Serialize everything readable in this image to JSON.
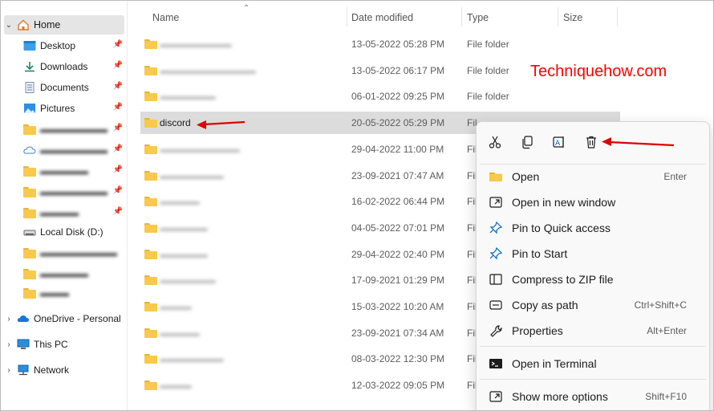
{
  "sidebar": {
    "home": "Home",
    "items": [
      {
        "label": "Desktop",
        "icon": "desktop-icon",
        "pinned": true
      },
      {
        "label": "Downloads",
        "icon": "download-icon",
        "pinned": true
      },
      {
        "label": "Documents",
        "icon": "document-icon",
        "pinned": true
      },
      {
        "label": "Pictures",
        "icon": "pictures-icon",
        "pinned": true
      },
      {
        "label": "",
        "icon": "folder-icon",
        "pinned": true
      },
      {
        "label": "",
        "icon": "onedrive-folder-icon",
        "pinned": true
      },
      {
        "label": "",
        "icon": "folder-icon",
        "pinned": true
      },
      {
        "label": "",
        "icon": "folder-icon",
        "pinned": true
      },
      {
        "label": "",
        "icon": "folder-icon",
        "pinned": true
      },
      {
        "label": "Local Disk (D:)",
        "icon": "drive-icon",
        "pinned": false
      },
      {
        "label": "",
        "icon": "folder-icon",
        "pinned": false
      },
      {
        "label": "",
        "icon": "folder-icon",
        "pinned": false
      },
      {
        "label": "",
        "icon": "folder-icon",
        "pinned": false
      }
    ],
    "sections": [
      {
        "label": "OneDrive - Personal",
        "icon": "cloud-icon"
      },
      {
        "label": "This PC",
        "icon": "pc-icon"
      },
      {
        "label": "Network",
        "icon": "network-icon"
      }
    ]
  },
  "columns": {
    "name": "Name",
    "date": "Date modified",
    "type": "Type",
    "size": "Size"
  },
  "rows": [
    {
      "name": "",
      "date": "13-05-2022 05:28 PM",
      "type": "File folder"
    },
    {
      "name": "",
      "date": "13-05-2022 06:17 PM",
      "type": "File folder"
    },
    {
      "name": "",
      "date": "06-01-2022 09:25 PM",
      "type": "File folder"
    },
    {
      "name": "discord",
      "date": "20-05-2022 05:29 PM",
      "type": "Fil"
    },
    {
      "name": "",
      "date": "29-04-2022 11:00 PM",
      "type": "Fil"
    },
    {
      "name": "",
      "date": "23-09-2021 07:47 AM",
      "type": "Fil"
    },
    {
      "name": "",
      "date": "16-02-2022 06:44 PM",
      "type": "Fil"
    },
    {
      "name": "",
      "date": "04-05-2022 07:01 PM",
      "type": "Fil"
    },
    {
      "name": "",
      "date": "29-04-2022 02:40 PM",
      "type": "Fil"
    },
    {
      "name": "",
      "date": "17-09-2021 01:29 PM",
      "type": "Fil"
    },
    {
      "name": "",
      "date": "15-03-2022 10:20 AM",
      "type": "Fil"
    },
    {
      "name": "",
      "date": "23-09-2021 07:34 AM",
      "type": "Fil"
    },
    {
      "name": "",
      "date": "08-03-2022 12:30 PM",
      "type": "Fil"
    },
    {
      "name": "",
      "date": "12-03-2022 09:05 PM",
      "type": "Fil"
    }
  ],
  "watermark": "Techniquehow.com",
  "context_menu": {
    "quick_actions": [
      "cut-icon",
      "copy-icon",
      "rename-icon",
      "delete-icon"
    ],
    "items": [
      {
        "label": "Open",
        "shortcut": "Enter",
        "icon": "folder-icon"
      },
      {
        "label": "Open in new window",
        "shortcut": "",
        "icon": "new-window-icon"
      },
      {
        "label": "Pin to Quick access",
        "shortcut": "",
        "icon": "pin-icon"
      },
      {
        "label": "Pin to Start",
        "shortcut": "",
        "icon": "pin-icon"
      },
      {
        "label": "Compress to ZIP file",
        "shortcut": "",
        "icon": "zip-icon"
      },
      {
        "label": "Copy as path",
        "shortcut": "Ctrl+Shift+C",
        "icon": "copy-path-icon"
      },
      {
        "label": "Properties",
        "shortcut": "Alt+Enter",
        "icon": "wrench-icon"
      },
      {
        "label": "Open in Terminal",
        "shortcut": "",
        "icon": "terminal-icon"
      },
      {
        "label": "Show more options",
        "shortcut": "Shift+F10",
        "icon": "more-options-icon"
      }
    ]
  },
  "colors": {
    "accent": "#0067c0",
    "annotation": "#ff0000",
    "folder": "#f8c94a",
    "selection": "#dcdcdc"
  }
}
